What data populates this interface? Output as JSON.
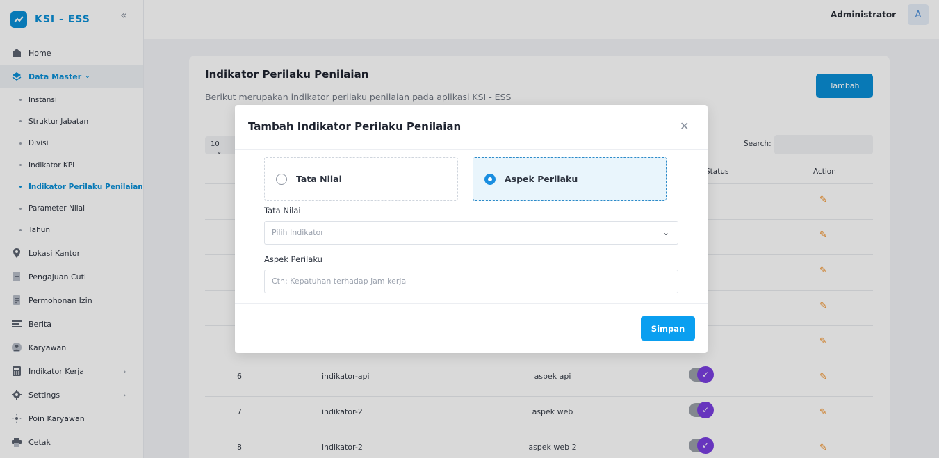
{
  "brand": {
    "title": "KSI - ESS"
  },
  "header": {
    "user_name": "Administrator",
    "avatar_initial": "A"
  },
  "sidebar": {
    "items": [
      {
        "label": "Home",
        "icon": "home-icon"
      },
      {
        "label": "Data Master",
        "icon": "layers-icon",
        "expanded": true,
        "children": [
          {
            "label": "Instansi"
          },
          {
            "label": "Struktur Jabatan"
          },
          {
            "label": "Divisi"
          },
          {
            "label": "Indikator KPI"
          },
          {
            "label": "Indikator Perilaku Penilaian",
            "active": true
          },
          {
            "label": "Parameter Nilai"
          },
          {
            "label": "Tahun"
          }
        ]
      },
      {
        "label": "Lokasi Kantor",
        "icon": "location-pin-icon"
      },
      {
        "label": "Pengajuan Cuti",
        "icon": "document-icon"
      },
      {
        "label": "Permohonan Izin",
        "icon": "file-icon"
      },
      {
        "label": "Berita",
        "icon": "news-icon"
      },
      {
        "label": "Karyawan",
        "icon": "user-icon"
      },
      {
        "label": "Indikator Kerja",
        "icon": "calculator-icon",
        "has_children": true
      },
      {
        "label": "Settings",
        "icon": "gear-icon",
        "has_children": true
      },
      {
        "label": "Poin Karyawan",
        "icon": "sparkle-icon"
      },
      {
        "label": "Cetak",
        "icon": "printer-icon"
      }
    ]
  },
  "page": {
    "title": "Indikator Perilaku Penilaian",
    "subtitle": "Berikut merupakan indikator perilaku penilaian pada aplikasi KSI - ESS",
    "add_button": "Tambah",
    "page_length": "10",
    "search_label": "Search:",
    "columns": {
      "status": "Status",
      "action": "Action"
    },
    "rows": [
      {
        "no": "6",
        "indikator": "indikator-api",
        "aspek": "aspek api",
        "status": true
      },
      {
        "no": "7",
        "indikator": "indikator-2",
        "aspek": "aspek web",
        "status": true
      },
      {
        "no": "8",
        "indikator": "indikator-2",
        "aspek": "aspek web 2",
        "status": true
      }
    ]
  },
  "modal": {
    "title": "Tambah Indikator Perilaku Penilaian",
    "options": [
      {
        "label": "Tata Nilai",
        "selected": false
      },
      {
        "label": "Aspek Perilaku",
        "selected": true
      }
    ],
    "tata_nilai_label": "Tata Nilai",
    "tata_nilai_placeholder": "Pilih Indikator",
    "aspek_label": "Aspek Perilaku",
    "aspek_placeholder": "Cth: Kepatuhan terhadap jam kerja",
    "submit": "Simpan"
  },
  "colors": {
    "primary": "#0a8fd6",
    "toggle_on": "#7a3fe0",
    "edit": "#f08a1c"
  }
}
